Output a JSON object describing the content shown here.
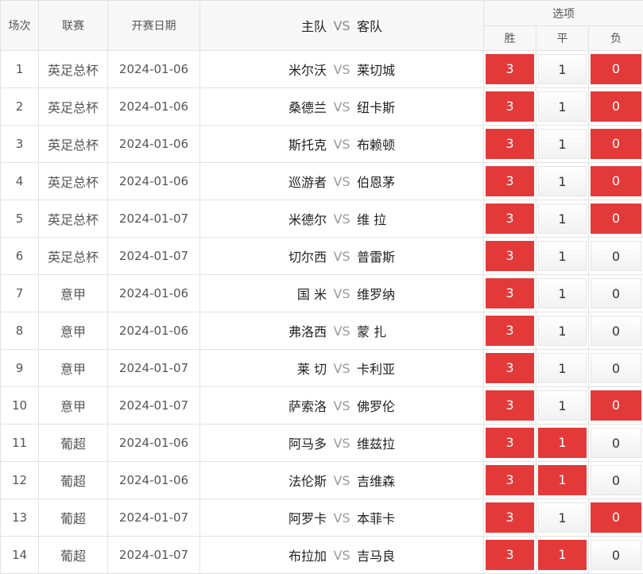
{
  "header": {
    "no": "场次",
    "league": "联赛",
    "date": "开赛日期",
    "home": "主队",
    "vs": "VS",
    "away": "客队",
    "options": "选项",
    "win": "胜",
    "draw": "平",
    "lose": "负"
  },
  "colors": {
    "selected": "#e33939",
    "unselected": "#f5f5f5"
  },
  "rows": [
    {
      "no": "1",
      "league": "英足总杯",
      "date": "2024-01-06",
      "home": "米尔沃",
      "away": "莱切城",
      "win": "3",
      "draw": "1",
      "lose": "0",
      "sel": [
        true,
        false,
        true
      ]
    },
    {
      "no": "2",
      "league": "英足总杯",
      "date": "2024-01-06",
      "home": "桑德兰",
      "away": "纽卡斯",
      "win": "3",
      "draw": "1",
      "lose": "0",
      "sel": [
        true,
        false,
        true
      ]
    },
    {
      "no": "3",
      "league": "英足总杯",
      "date": "2024-01-06",
      "home": "斯托克",
      "away": "布赖顿",
      "win": "3",
      "draw": "1",
      "lose": "0",
      "sel": [
        true,
        false,
        true
      ]
    },
    {
      "no": "4",
      "league": "英足总杯",
      "date": "2024-01-06",
      "home": "巡游者",
      "away": "伯恩茅",
      "win": "3",
      "draw": "1",
      "lose": "0",
      "sel": [
        true,
        false,
        true
      ]
    },
    {
      "no": "5",
      "league": "英足总杯",
      "date": "2024-01-07",
      "home": "米德尔",
      "away": "维 拉",
      "win": "3",
      "draw": "1",
      "lose": "0",
      "sel": [
        true,
        false,
        true
      ]
    },
    {
      "no": "6",
      "league": "英足总杯",
      "date": "2024-01-07",
      "home": "切尔西",
      "away": "普雷斯",
      "win": "3",
      "draw": "1",
      "lose": "0",
      "sel": [
        true,
        false,
        false
      ]
    },
    {
      "no": "7",
      "league": "意甲",
      "date": "2024-01-06",
      "home": "国 米",
      "away": "维罗纳",
      "win": "3",
      "draw": "1",
      "lose": "0",
      "sel": [
        true,
        false,
        false
      ]
    },
    {
      "no": "8",
      "league": "意甲",
      "date": "2024-01-06",
      "home": "弗洛西",
      "away": "蒙 扎",
      "win": "3",
      "draw": "1",
      "lose": "0",
      "sel": [
        true,
        false,
        false
      ]
    },
    {
      "no": "9",
      "league": "意甲",
      "date": "2024-01-07",
      "home": "莱 切",
      "away": "卡利亚",
      "win": "3",
      "draw": "1",
      "lose": "0",
      "sel": [
        true,
        false,
        false
      ]
    },
    {
      "no": "10",
      "league": "意甲",
      "date": "2024-01-07",
      "home": "萨索洛",
      "away": "佛罗伦",
      "win": "3",
      "draw": "1",
      "lose": "0",
      "sel": [
        true,
        false,
        true
      ]
    },
    {
      "no": "11",
      "league": "葡超",
      "date": "2024-01-06",
      "home": "阿马多",
      "away": "维兹拉",
      "win": "3",
      "draw": "1",
      "lose": "0",
      "sel": [
        true,
        true,
        false
      ]
    },
    {
      "no": "12",
      "league": "葡超",
      "date": "2024-01-06",
      "home": "法伦斯",
      "away": "吉维森",
      "win": "3",
      "draw": "1",
      "lose": "0",
      "sel": [
        true,
        true,
        false
      ]
    },
    {
      "no": "13",
      "league": "葡超",
      "date": "2024-01-07",
      "home": "阿罗卡",
      "away": "本菲卡",
      "win": "3",
      "draw": "1",
      "lose": "0",
      "sel": [
        true,
        false,
        true
      ]
    },
    {
      "no": "14",
      "league": "葡超",
      "date": "2024-01-07",
      "home": "布拉加",
      "away": "吉马良",
      "win": "3",
      "draw": "1",
      "lose": "0",
      "sel": [
        true,
        true,
        false
      ]
    }
  ]
}
